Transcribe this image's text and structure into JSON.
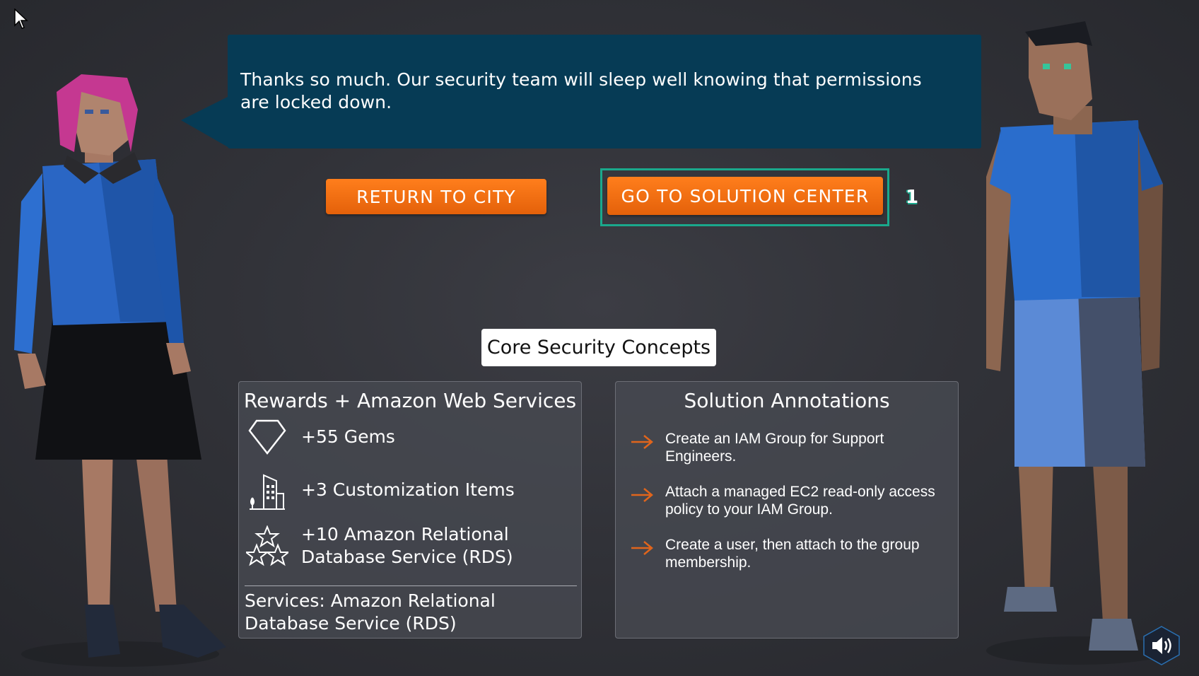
{
  "dialog": {
    "message": "Thanks so much. Our security team will sleep well knowing that permissions are locked down."
  },
  "buttons": {
    "return_label": "RETURN TO CITY",
    "solution_label": "GO TO SOLUTION CENTER",
    "focus_badge": "1"
  },
  "topic_label": "Core Security Concepts",
  "rewards": {
    "title": "Rewards + Amazon Web Services",
    "items": [
      {
        "icon": "gem-icon",
        "text": "+55 Gems"
      },
      {
        "icon": "buildings-icon",
        "text": "+3 Customization Items"
      },
      {
        "icon": "stars-icon",
        "text": "+10 Amazon Relational Database Service (RDS)"
      }
    ],
    "services": "Services: Amazon Relational Database Service (RDS)"
  },
  "solution": {
    "title": "Solution Annotations",
    "steps": [
      "Create an IAM Group for Support Engineers.",
      "Attach a managed EC2 read-only access policy to your IAM Group.",
      "Create a user, then attach to the group membership."
    ]
  },
  "colors": {
    "bubble": "#063b55",
    "button": "#f26f13",
    "focus": "#1aa88c",
    "arrow": "#e0651c"
  },
  "icons": {
    "cursor": "cursor-arrow-icon",
    "sound": "speaker-icon"
  }
}
